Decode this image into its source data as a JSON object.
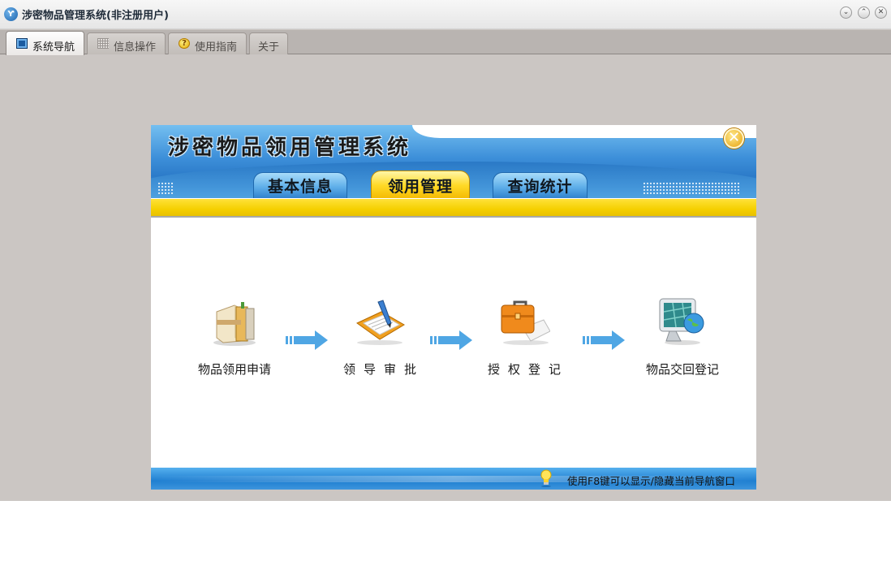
{
  "window": {
    "icon_glyph": "Ƴ",
    "title": "涉密物品管理系统(非注册用户)",
    "minimize_glyph": "⌄",
    "maximize_glyph": "⌃",
    "close_glyph": "✕"
  },
  "tabs": [
    {
      "label": "系统导航",
      "icon": "monitor-icon",
      "active": true
    },
    {
      "label": "信息操作",
      "icon": "grid-icon",
      "active": false
    },
    {
      "label": "使用指南",
      "icon": "help-icon",
      "active": false
    },
    {
      "label": "关于",
      "icon": "",
      "active": false
    }
  ],
  "panel": {
    "title": "涉密物品领用管理系统",
    "close_glyph": "✕",
    "nav_tabs": [
      {
        "label": "基本信息",
        "active": false
      },
      {
        "label": "领用管理",
        "active": true
      },
      {
        "label": "查询统计",
        "active": false
      }
    ],
    "steps": [
      {
        "label": "物品领用申请",
        "icon": "books-icon"
      },
      {
        "label": "领导审批",
        "icon": "notebook-pen-icon"
      },
      {
        "label": "授权登记",
        "icon": "briefcase-icon"
      },
      {
        "label": "物品交回登记",
        "icon": "monitor-globe-icon"
      }
    ],
    "footer_hint": "使用F8键可以显示/隐藏当前导航窗口"
  },
  "colors": {
    "accent_blue": "#2c7bc9",
    "accent_yellow": "#f5d000",
    "arrow_blue": "#4fa6e4"
  }
}
